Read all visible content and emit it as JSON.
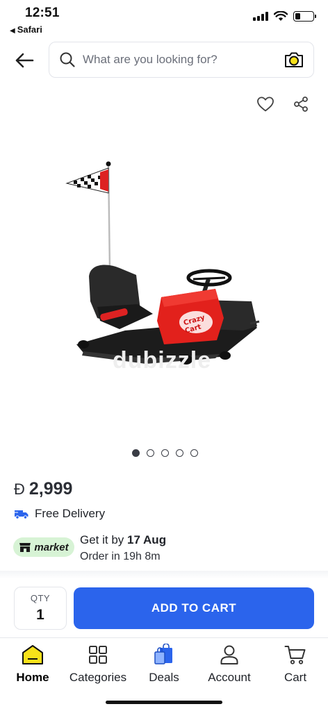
{
  "status_bar": {
    "time": "12:51",
    "back_app": "Safari"
  },
  "search": {
    "placeholder": "What are you looking for?"
  },
  "product": {
    "watermark": "dubizzle",
    "image_count": 5,
    "active_image_index": 0,
    "currency_symbol": "Đ",
    "price": "2,999",
    "delivery_text": "Free Delivery",
    "market_badge": "market",
    "eta_prefix": "Get it by ",
    "eta_date": "17 Aug",
    "eta_order_in": "Order in 19h 8m"
  },
  "cart": {
    "qty_label": "QTY",
    "qty_value": "1",
    "add_to_cart_label": "ADD TO CART"
  },
  "tabs": [
    {
      "label": "Home",
      "icon": "home-icon",
      "active": true
    },
    {
      "label": "Categories",
      "icon": "categories-icon",
      "active": false
    },
    {
      "label": "Deals",
      "icon": "deals-icon",
      "active": false
    },
    {
      "label": "Account",
      "icon": "account-icon",
      "active": false
    },
    {
      "label": "Cart",
      "icon": "cart-icon",
      "active": false
    }
  ],
  "colors": {
    "accent": "#2b64ec",
    "market_badge_bg": "#d7f3d5",
    "home_icon": "#f7e11a",
    "kart_red": "#e2211c"
  }
}
